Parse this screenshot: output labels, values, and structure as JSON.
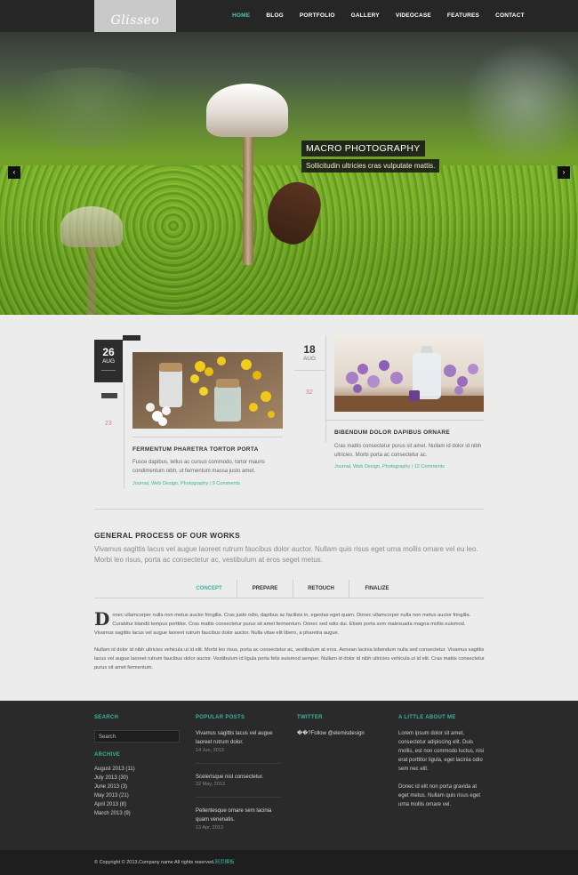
{
  "header": {
    "logo": "Glisseo",
    "nav": [
      "HOME",
      "BLOG",
      "PORTFOLIO",
      "GALLERY",
      "VIDEOCASE",
      "FEATURES",
      "CONTACT"
    ]
  },
  "hero": {
    "caption_title": "MACRO PHOTOGRAPHY",
    "caption_sub": "Sollicitudin ultricies cras vulputate mattis.",
    "prev": "‹",
    "next": "›"
  },
  "posts": [
    {
      "day": "26",
      "month": "AUG",
      "comments": "23",
      "title": "FERMENTUM PHARETRA TORTOR PORTA",
      "text": "Fusce dapibus, tellus ac cursus commodo, tortor mauris condimentum nibh, ut fermentum massa justo amet.",
      "cats": "Journal, Web Design, Photography",
      "comment_link": "9 Comments"
    },
    {
      "day": "18",
      "month": "AUG",
      "comments": "32",
      "title": "BIBENDUM DOLOR DAPIBUS ORNARE",
      "text": "Cras mattis consectetur purus sit amet. Nullam id dolor id nibh ultricies. Morbi porta ac consectetur ac.",
      "cats": "Journal, Web Design, Photography",
      "comment_link": "12 Comments"
    }
  ],
  "process": {
    "title": "GENERAL PROCESS OF OUR WORKS",
    "sub": "Vivamus sagittis lacus vel augue laoreet rutrum faucibus dolor auctor. Nullam quis risus eget urna mollis ornare vel eu leo. Morbi leo risus, porta ac consectetur ac, vestibulum at eros seget metus.",
    "tabs": [
      "CONCEPT",
      "PREPARE",
      "RETOUCH",
      "FINALIZE"
    ],
    "dropcap": "D",
    "para1": "onec ullamcorper nulla non metus auctor fringilla. Cras justo odio, dapibus ac facilisis in, egestas eget quam. Donec ullamcorper nulla non metus auctor fringilla. Curabitur blandit tempus porttitor. Cras mattis consectetur purus sit amet fermentum. Donec sed odio dui. Etiam porta sem malesuada magna mollis euismod. Vivamus sagittis lacus vel augue laoreet rutrum faucibus dolor auctor. Nulla vitae elit libero, a pharetra augue.",
    "para2": "Nullam id dolor id nibh ultricies vehicula ut id elit. Morbi leo risus, porta ac consectetur ac, vestibulum at eros. Aenean lacinia bibendum nulla sed consectetur. Vivamus sagittis lacus vel augue laoreet rutrum faucibus dolor auctor. Vestibulum id ligula porta felis euismod semper. Nullam id dolor id nibh ultricies vehicula ut id elit. Cras mattis consectetur purus sit amet fermentum."
  },
  "footer": {
    "search_head": "SEARCH",
    "search_placeholder": "Search",
    "archive_head": "ARCHIVE",
    "archive": [
      "August 2013 (11)",
      "July 2013 (30)",
      "June 2013 (3)",
      "May 2013 (21)",
      "April 2013 (8)",
      "March 2013 (9)"
    ],
    "popular_head": "POPULAR POSTS",
    "popular": [
      {
        "title": "Vivamus sagittis lacus vel augue laoreet rutrum dolor.",
        "date": "14 Jun, 2013"
      },
      {
        "title": "Scelerisque nisl consectetur.",
        "date": "22 May, 2013"
      },
      {
        "title": "Pellentesque ornare sem lacinia quam venenatis.",
        "date": "13 Apr, 2013"
      }
    ],
    "twitter_head": "TWITTER",
    "twitter_text": "��?Follow @elemisdesign",
    "about_head": "A LITTLE ABOUT ME",
    "about1": "Lorem ipsum dolor sit amet, consectetur adipiscing elit. Duis mollis, est non commodo luctus, nisi erat porttitor ligula, eget lacinia odio sem nec elit.",
    "about2": "Donec id elit non porta gravida at eget metus. Nullam quis risus eget urna mollis ornare vel.",
    "copyright": "© Copyright © 2013.Company name All rights reserved.",
    "copyright_link": "网页模板"
  }
}
